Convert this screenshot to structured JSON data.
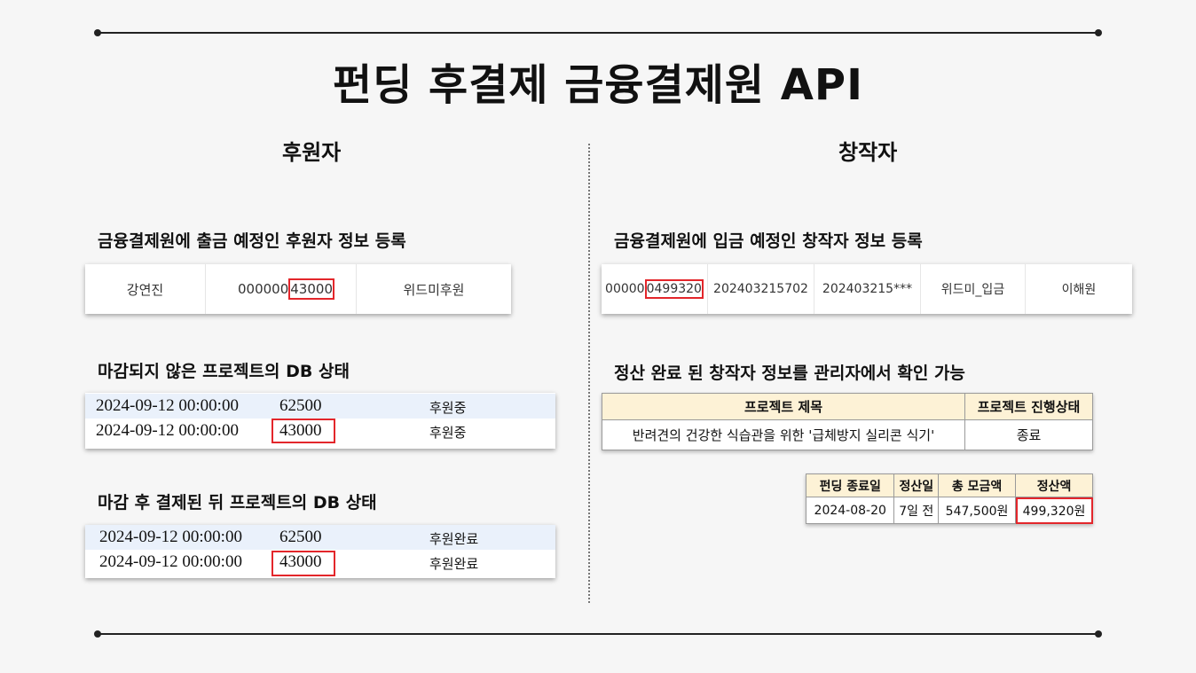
{
  "title": "펀딩 후결제 금융결제원 API",
  "left": {
    "heading": "후원자",
    "register_title": "금융결제원에 출금 예정인 후원자 정보 등록",
    "register_row": {
      "name": "강연진",
      "amount_prefix": "000000",
      "amount_highlight": "43000",
      "memo": "위드미후원"
    },
    "open_title": "마감되지 않은 프로젝트의 DB 상태",
    "open_rows": [
      {
        "date": "2024-09-12 00:00:00",
        "amount": "62500",
        "status": "후원중"
      },
      {
        "date": "2024-09-12 00:00:00",
        "amount": "43000",
        "status": "후원중"
      }
    ],
    "closed_title": "마감 후 결제된 뒤 프로젝트의 DB 상태",
    "closed_rows": [
      {
        "date": "2024-09-12 00:00:00",
        "amount": "62500",
        "status": "후원완료"
      },
      {
        "date": "2024-09-12 00:00:00",
        "amount": "43000",
        "status": "후원완료"
      }
    ]
  },
  "right": {
    "heading": "창작자",
    "register_title": "금융결제원에 입금 예정인 창작자 정보 등록",
    "register_row": {
      "amount_prefix": "00000",
      "amount_highlight": "0499320",
      "code1": "202403215702",
      "code2": "202403215***",
      "memo": "위드미_입금",
      "name": "이해원"
    },
    "settle_title": "정산 완료 된 창작자 정보를 관리자에서 확인 가능",
    "project_table": {
      "headers": [
        "프로젝트 제목",
        "프로젝트 진행상태"
      ],
      "row": [
        "반려견의 건강한 식습관을 위한 '급체방지 실리콘 식기'",
        "종료"
      ]
    },
    "settle_table": {
      "headers": [
        "펀딩 종료일",
        "정산일",
        "총 모금액",
        "정산액"
      ],
      "row": [
        "2024-08-20",
        "7일 전",
        "547,500원",
        "499,320원"
      ]
    }
  }
}
